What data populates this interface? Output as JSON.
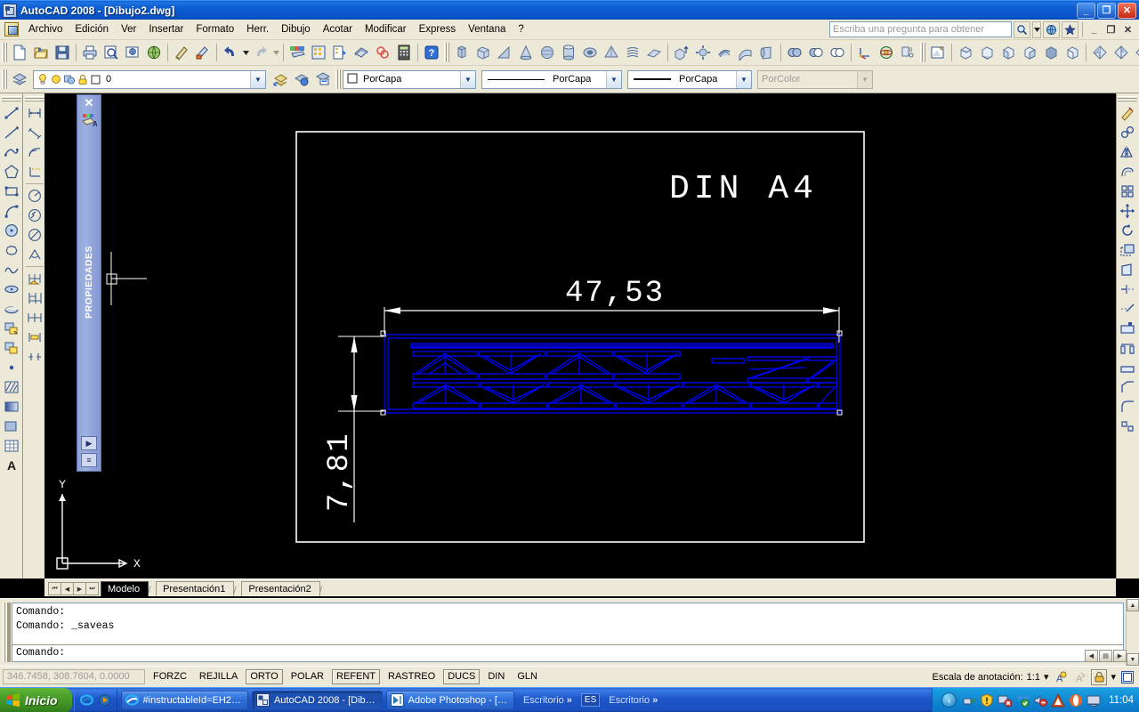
{
  "window": {
    "title": "AutoCAD 2008 - [Dibujo2.dwg]",
    "app_icon": "autocad-icon",
    "minimize": "_",
    "maximize": "❐",
    "close": "✕",
    "mdi_minimize": "_",
    "mdi_restore": "❐",
    "mdi_close": "✕"
  },
  "menu": {
    "items": [
      {
        "label": "Archivo",
        "name": "menu-archivo"
      },
      {
        "label": "Edición",
        "name": "menu-edicion"
      },
      {
        "label": "Ver",
        "name": "menu-ver"
      },
      {
        "label": "Insertar",
        "name": "menu-insertar"
      },
      {
        "label": "Formato",
        "name": "menu-formato"
      },
      {
        "label": "Herr.",
        "name": "menu-herramientas"
      },
      {
        "label": "Dibujo",
        "name": "menu-dibujo"
      },
      {
        "label": "Acotar",
        "name": "menu-acotar"
      },
      {
        "label": "Modificar",
        "name": "menu-modificar"
      },
      {
        "label": "Express",
        "name": "menu-express"
      },
      {
        "label": "Ventana",
        "name": "menu-ventana"
      },
      {
        "label": "?",
        "name": "menu-ayuda"
      }
    ],
    "help_placeholder": "Escriba una pregunta para obtener ayuda",
    "help_value": ""
  },
  "layer_toolbar": {
    "current_layer": "0",
    "layer_icons": [
      "lightbulb-icon",
      "sun-icon",
      "freeze-icon",
      "lock-icon",
      "color-swatch-icon"
    ]
  },
  "properties_toolbar": {
    "color": "PorCapa",
    "linetype": "PorCapa",
    "lineweight": "PorCapa",
    "plotstyle": "PorColor",
    "plotstyle_disabled": true
  },
  "palette": {
    "title": "PROPIEDADES",
    "close_label": "✕",
    "icon": "quick-select-icon",
    "autohide_label": "▶",
    "menu_label": "≡"
  },
  "drawing": {
    "title_text": "DIN  A4",
    "dim_horizontal": "47,53",
    "dim_vertical": "7,81",
    "ucs_x_label": "X",
    "ucs_y_label": "Y",
    "entity_color": "#0000ff",
    "frame_color": "#ffffff",
    "background": "#000000"
  },
  "layout_tabs": {
    "nav": [
      "⏮",
      "◀",
      "▶",
      "⏭"
    ],
    "tabs": [
      {
        "label": "Modelo",
        "active": true
      },
      {
        "label": "Presentación1",
        "active": false
      },
      {
        "label": "Presentación2",
        "active": false
      }
    ]
  },
  "command_window": {
    "history": [
      "Comando:",
      "Comando: _saveas"
    ],
    "prompt": "Comando:",
    "scroll_up": "▲",
    "scroll_down": "▼",
    "scroll_left": "◀",
    "scroll_right": "▶"
  },
  "status_bar": {
    "coordinates": "346.7458, 308.7604, 0.0000",
    "toggles": [
      {
        "label": "FORZC",
        "on": false
      },
      {
        "label": "REJILLA",
        "on": false
      },
      {
        "label": "ORTO",
        "on": true
      },
      {
        "label": "POLAR",
        "on": false
      },
      {
        "label": "REFENT",
        "on": true
      },
      {
        "label": "RASTREO",
        "on": false
      },
      {
        "label": "DUCS",
        "on": true
      },
      {
        "label": "DIN",
        "on": false
      },
      {
        "label": "GLN",
        "on": false
      }
    ],
    "annotation_label": "Escala de anotación:",
    "annotation_scale": "1:1",
    "annotation_arrow": "▾",
    "lock_arrow": "▾",
    "icons": [
      "annotation-visibility-icon",
      "annotation-auto-scale-icon",
      "toolbar-lock-icon",
      "clean-screen-icon"
    ]
  },
  "taskbar": {
    "start_label": "Inicio",
    "quick_launch": [
      "internet-explorer-icon",
      "media-player-icon"
    ],
    "buttons": [
      {
        "label": "#instructableId=EH2…",
        "icon": "internet-explorer-icon",
        "active": false
      },
      {
        "label": "AutoCAD 2008 - [Dib…",
        "icon": "autocad-icon",
        "active": true
      },
      {
        "label": "Adobe Photoshop - […",
        "icon": "photoshop-icon",
        "active": false
      }
    ],
    "desktop_bars": [
      {
        "label": "Escritorio",
        "chevron": "»"
      },
      {
        "label": "Escritorio",
        "chevron": "»"
      }
    ],
    "language": "ES",
    "tray_toggle": "‹",
    "tray_icons": [
      "network-icon",
      "security-alert-icon",
      "updates-icon",
      "dropbox-icon",
      "volume-muted-icon",
      "autocad-tray-icon",
      "opera-icon",
      "display-icon"
    ],
    "clock": "11:04"
  },
  "chart_data": null
}
